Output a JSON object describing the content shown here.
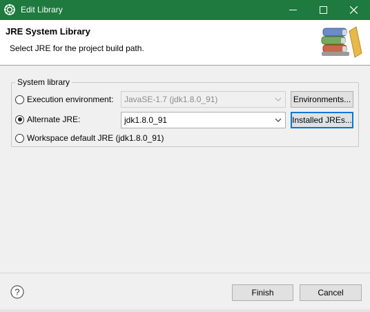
{
  "window": {
    "title": "Edit Library",
    "minimize_icon": "minimize-icon",
    "maximize_icon": "maximize-icon",
    "close_icon": "close-icon",
    "title_bar_color": "#1e7a3e"
  },
  "header": {
    "title": "JRE System Library",
    "description": "Select JRE for the project build path.",
    "banner_icon": "library-books-icon"
  },
  "group": {
    "label": "System library",
    "options": {
      "execution_env": {
        "label": "Execution environment:",
        "checked": false,
        "combo_value": "JavaSE-1.7 (jdk1.8.0_91)",
        "combo_enabled": false,
        "button_label": "Environments..."
      },
      "alternate_jre": {
        "label": "Alternate JRE:",
        "checked": true,
        "combo_value": "jdk1.8.0_91",
        "combo_enabled": true,
        "button_label": "Installed JREs..."
      },
      "workspace_default": {
        "label": "Workspace default JRE (jdk1.8.0_91)",
        "checked": false
      }
    }
  },
  "footer": {
    "help_icon": "help-icon",
    "finish_label": "Finish",
    "cancel_label": "Cancel"
  }
}
